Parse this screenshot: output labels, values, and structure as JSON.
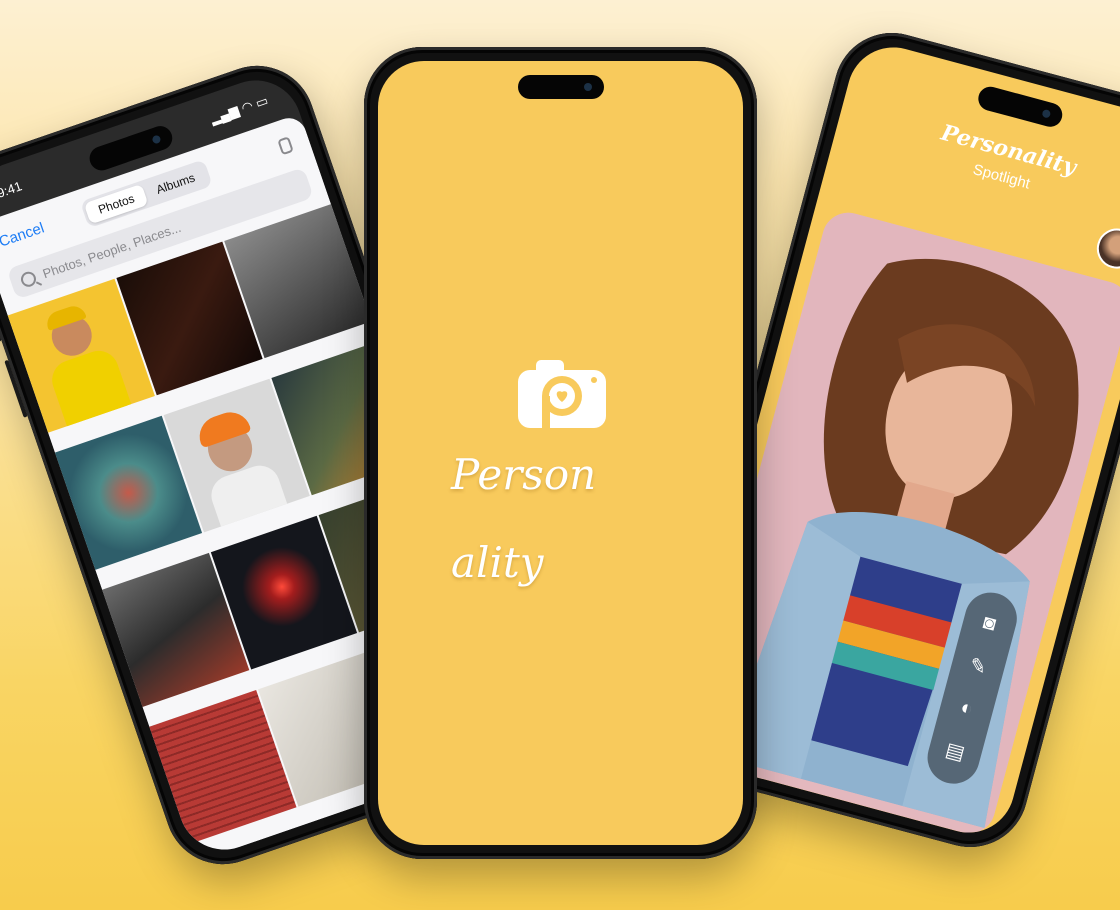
{
  "left_phone": {
    "time": "9:41",
    "cancel_label": "Cancel",
    "tabs": [
      {
        "label": "Photos",
        "selected": true
      },
      {
        "label": "Albums",
        "selected": false
      }
    ],
    "search_placeholder": "Photos, People, Places..."
  },
  "center_phone": {
    "app_name": "Personality"
  },
  "right_phone": {
    "title": "Personality",
    "subtitle": "Spotlight",
    "actions": [
      "camera-icon",
      "brush-icon",
      "video-icon",
      "chat-icon"
    ]
  },
  "colors": {
    "brand_yellow": "#f8ca5c",
    "ios_blue": "#1e7df5"
  }
}
